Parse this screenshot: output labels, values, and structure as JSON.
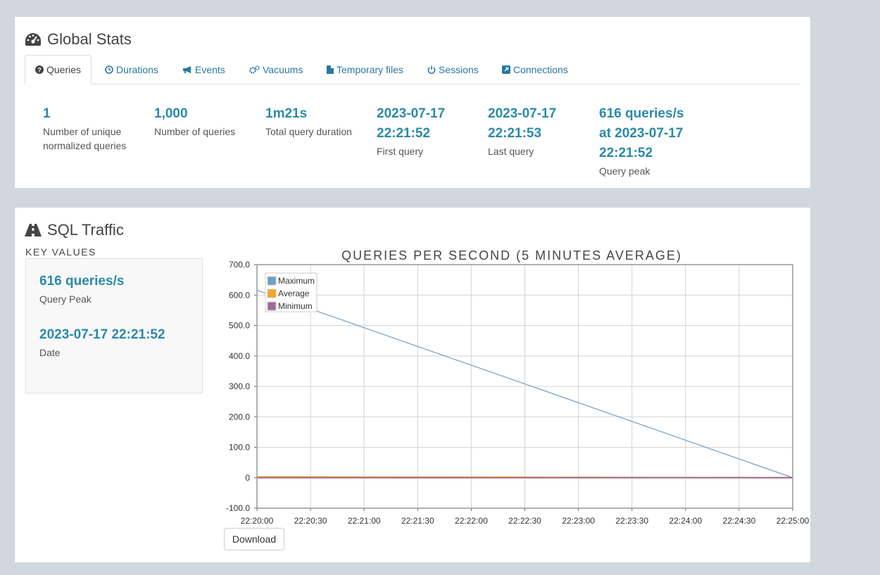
{
  "global_stats": {
    "title": "Global Stats",
    "tabs": [
      {
        "label": "Queries",
        "icon": "question-circle-icon"
      },
      {
        "label": "Durations",
        "icon": "clock-icon"
      },
      {
        "label": "Events",
        "icon": "bullhorn-icon"
      },
      {
        "label": "Vacuums",
        "icon": "gears-icon"
      },
      {
        "label": "Temporary files",
        "icon": "file-icon"
      },
      {
        "label": "Sessions",
        "icon": "power-icon"
      },
      {
        "label": "Connections",
        "icon": "external-link-icon"
      }
    ],
    "active_tab": "Queries",
    "stats": [
      {
        "value_lines": [
          "1"
        ],
        "label": "Number of unique normalized queries"
      },
      {
        "value_lines": [
          "1,000"
        ],
        "label": "Number of queries"
      },
      {
        "value_lines": [
          "1m21s"
        ],
        "label": "Total query duration"
      },
      {
        "value_lines": [
          "2023-07-17",
          "22:21:52"
        ],
        "label": "First query"
      },
      {
        "value_lines": [
          "2023-07-17",
          "22:21:53"
        ],
        "label": "Last query"
      },
      {
        "value_lines": [
          "616 queries/s",
          "at 2023-07-17",
          "22:21:52"
        ],
        "label": "Query peak"
      }
    ]
  },
  "sql_traffic": {
    "title": "SQL Traffic",
    "key_values_header": "KEY VALUES",
    "key_values": [
      {
        "value": "616 queries/s",
        "label": "Query Peak"
      },
      {
        "value": "2023-07-17 22:21:52",
        "label": "Date"
      }
    ],
    "download_label": "Download"
  },
  "colors": {
    "accent": "#2a8aa6",
    "link": "#2a78a0",
    "panel_bg": "#ffffff",
    "page_bg": "#d0d7de"
  },
  "chart_data": {
    "type": "line",
    "title": "QUERIES PER SECOND (5 MINUTES AVERAGE)",
    "x": [
      "22:20:00",
      "22:25:00"
    ],
    "x_ticks": [
      "22:20:00",
      "22:20:30",
      "22:21:00",
      "22:21:30",
      "22:22:00",
      "22:22:30",
      "22:23:00",
      "22:23:30",
      "22:24:00",
      "22:24:30",
      "22:25:00"
    ],
    "y_ticks": [
      "-100.0",
      "0",
      "100.0",
      "200.0",
      "300.0",
      "400.0",
      "500.0",
      "600.0",
      "700.0"
    ],
    "ylim": [
      -100,
      700
    ],
    "grid": true,
    "legend_position": "top-left",
    "series": [
      {
        "name": "Maximum",
        "color": "#6f9fc4",
        "values": [
          616,
          0
        ]
      },
      {
        "name": "Average",
        "color": "#f5a623",
        "values": [
          3,
          0
        ]
      },
      {
        "name": "Minimum",
        "color": "#9e6b99",
        "values": [
          0,
          0
        ]
      }
    ]
  }
}
